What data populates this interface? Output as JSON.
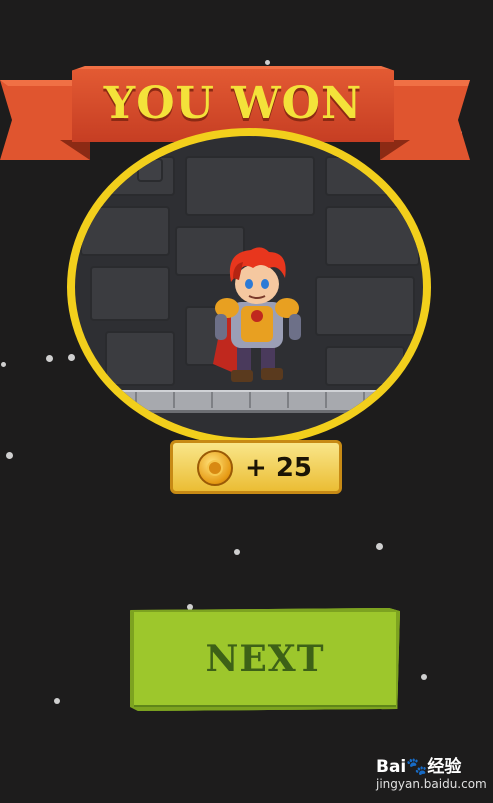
{
  "title": "YOU WON",
  "reward": {
    "amount_text": "+ 25",
    "icon": "coin-icon"
  },
  "buttons": {
    "next_label": "NEXT"
  },
  "watermark": {
    "brand": "Bai🐾经验",
    "url": "jingyan.baidu.com"
  },
  "colors": {
    "ribbon": "#d94a2b",
    "title_text": "#f4e23a",
    "ring": "#f2cf1c",
    "button": "#9dc72c",
    "button_text": "#3d6117",
    "background": "#1d1c1c"
  }
}
